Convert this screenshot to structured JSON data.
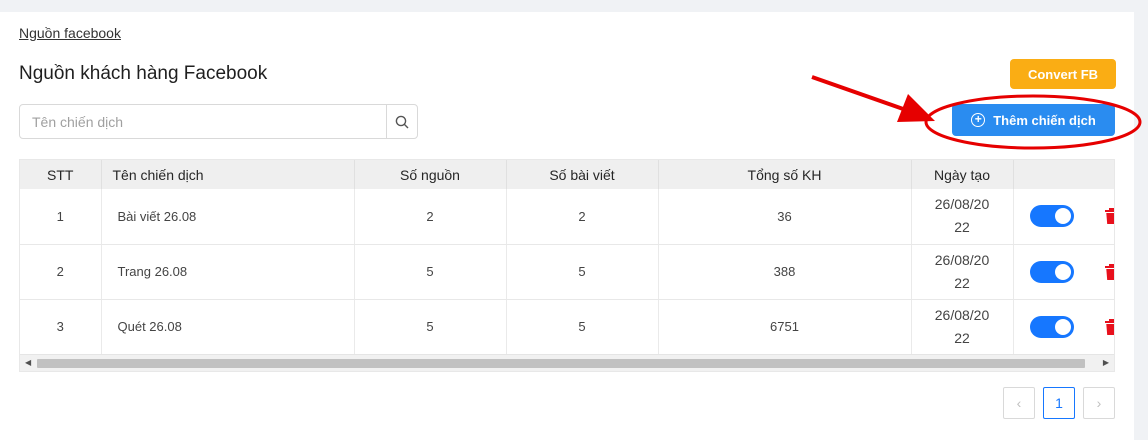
{
  "breadcrumb": "Nguồn facebook",
  "page_title": "Nguồn khách hàng Facebook",
  "buttons": {
    "convert": "Convert FB",
    "add_campaign": "Thêm chiến dịch"
  },
  "search": {
    "placeholder": "Tên chiến dịch",
    "value": ""
  },
  "table": {
    "columns": [
      "STT",
      "Tên chiến dịch",
      "Số nguồn",
      "Số bài viết",
      "Tổng số KH",
      "Ngày tạo",
      ""
    ],
    "rows": [
      {
        "stt": "1",
        "name": "Bài viết 26.08",
        "sources": "2",
        "posts": "2",
        "customers": "36",
        "date_line1": "26/08/20",
        "date_line2": "22",
        "active": true
      },
      {
        "stt": "2",
        "name": "Trang 26.08",
        "sources": "5",
        "posts": "5",
        "customers": "388",
        "date_line1": "26/08/20",
        "date_line2": "22",
        "active": true
      },
      {
        "stt": "3",
        "name": "Quét 26.08",
        "sources": "5",
        "posts": "5",
        "customers": "6751",
        "date_line1": "26/08/20",
        "date_line2": "22",
        "active": true
      }
    ]
  },
  "pagination": {
    "prev": "‹",
    "current": "1",
    "next": "›"
  },
  "colors": {
    "primary": "#2a8cf0",
    "warning": "#faad14",
    "danger": "#e8101c",
    "annotation": "#e60000"
  }
}
